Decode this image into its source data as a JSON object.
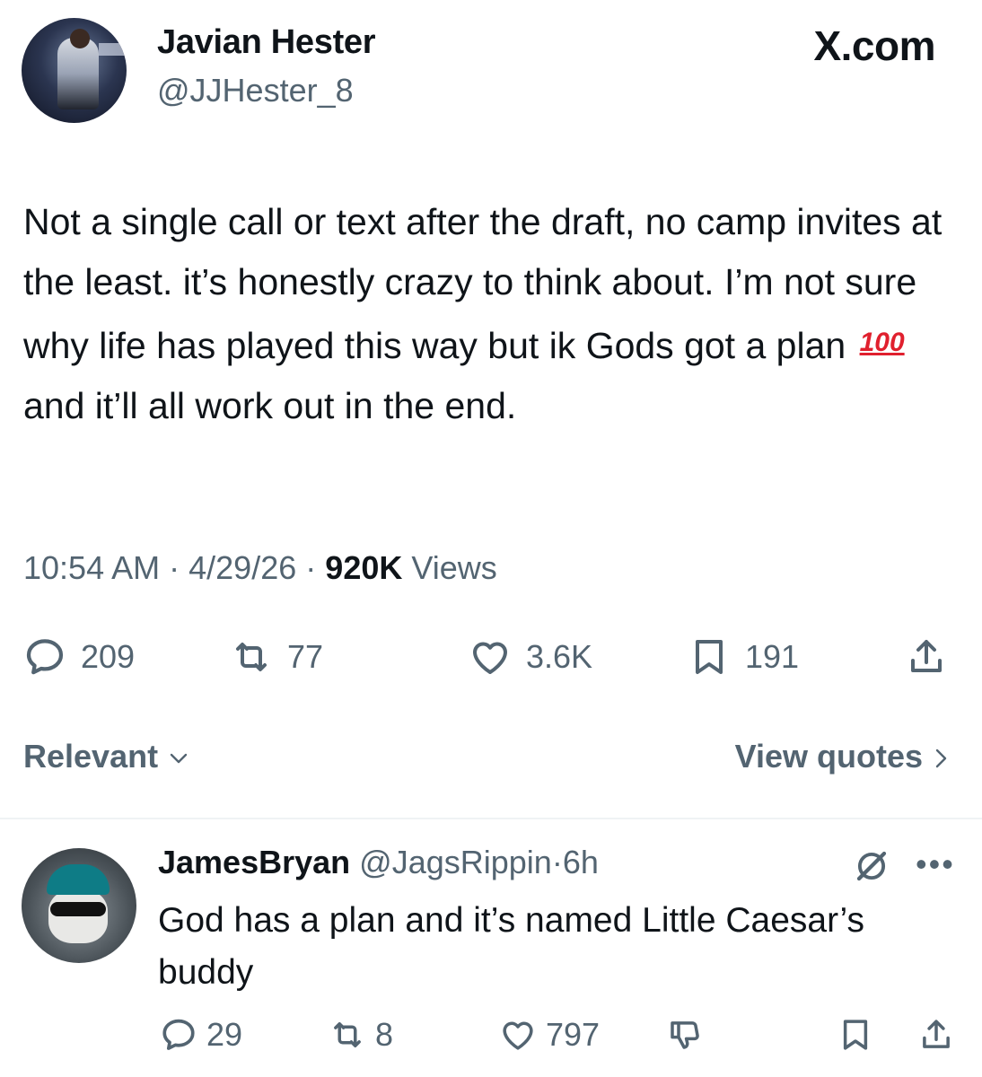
{
  "author": {
    "display_name": "Javian Hester",
    "handle": "@JJHester_8"
  },
  "brand": "X.com",
  "tweet": {
    "text_before_emoji": "Not a single call or text after the draft, no camp invites at the least. it’s honestly crazy to think about. I’m not sure why life has played this way but ik Gods got a plan ",
    "emoji": "100",
    "text_after_emoji": " and it’ll all work out in the end.",
    "time": "10:54 AM",
    "date": "4/29/26",
    "views_count": "920K",
    "views_label": "Views",
    "separator": "·"
  },
  "actions": {
    "replies": "209",
    "reposts": "77",
    "likes": "3.6K",
    "bookmarks": "191"
  },
  "sort": {
    "label": "Relevant",
    "view_quotes": "View quotes"
  },
  "reply": {
    "name": "JamesBryan",
    "handle": "@JagsRippin",
    "time": "6h",
    "separator": "·",
    "text": "God has a plan and it’s named Little Caesar’s buddy",
    "replies": "29",
    "reposts": "8",
    "likes": "797"
  },
  "colors": {
    "text": "#0f1419",
    "secondary": "#536471",
    "divider": "#eff3f4",
    "emoji_red": "#e0202e"
  }
}
